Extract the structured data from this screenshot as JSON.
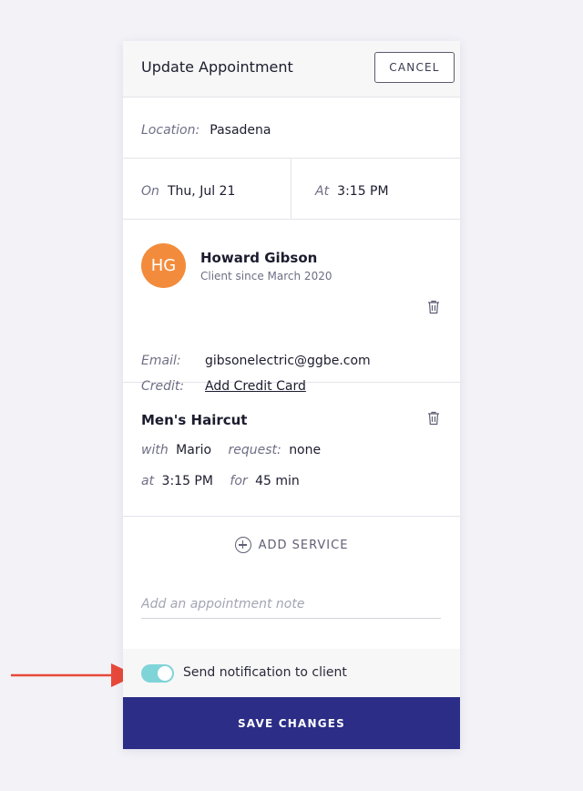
{
  "header": {
    "title": "Update Appointment",
    "cancel_label": "CANCEL"
  },
  "location": {
    "label": "Location:",
    "value": "Pasadena"
  },
  "datetime": {
    "date_label": "On",
    "date_value": "Thu, Jul 21",
    "time_label": "At",
    "time_value": "3:15 PM"
  },
  "client": {
    "initials": "HG",
    "name": "Howard Gibson",
    "since": "Client since March 2020",
    "email_label": "Email:",
    "email_value": "gibsonelectric@ggbe.com",
    "credit_label": "Credit:",
    "credit_link": "Add Credit Card",
    "avatar_color": "#f28c3c"
  },
  "service": {
    "name": "Men's Haircut",
    "with_label": "with",
    "with_value": "Mario",
    "request_label": "request:",
    "request_value": "none",
    "at_label": "at",
    "at_value": "3:15 PM",
    "for_label": "for",
    "for_value": "45 min"
  },
  "add_service_label": "ADD SERVICE",
  "note": {
    "placeholder": "Add an appointment note",
    "value": ""
  },
  "notification": {
    "label": "Send notification to client",
    "enabled": true,
    "toggle_color": "#7fd4d8"
  },
  "save_label": "SAVE CHANGES",
  "colors": {
    "primary": "#2b2d86",
    "annotation_arrow": "#e8483a"
  },
  "icons": [
    "trash-icon",
    "plus-circle-icon",
    "annotation-arrow"
  ]
}
